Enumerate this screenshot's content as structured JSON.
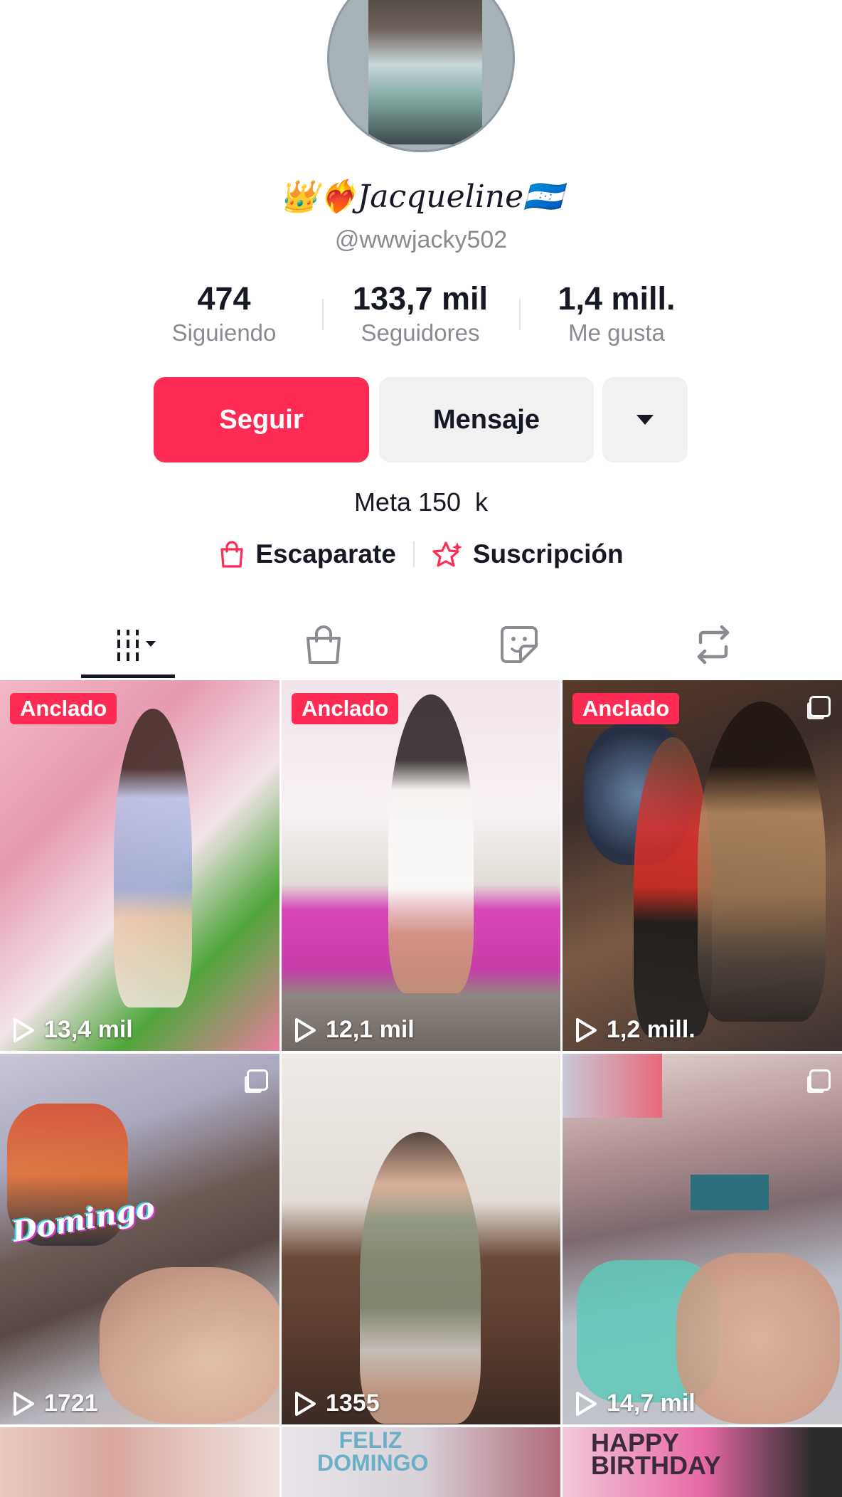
{
  "profile": {
    "display_name": "👑❤️‍🔥Jacqueline🇭🇳",
    "handle": "@wwwjacky502",
    "bio": "Meta 150  k"
  },
  "stats": [
    {
      "value": "474",
      "label": "Siguiendo"
    },
    {
      "value": "133,7 mil",
      "label": "Seguidores"
    },
    {
      "value": "1,4 mill.",
      "label": "Me gusta"
    }
  ],
  "actions": {
    "follow": "Seguir",
    "message": "Mensaje"
  },
  "links": {
    "shop": "Escaparate",
    "subscription": "Suscripción"
  },
  "tabs": [
    "videos-grid-icon",
    "shop-bag-icon",
    "private-sticker-icon",
    "repost-icon"
  ],
  "colors": {
    "accent": "#fe2c55",
    "text": "#161823",
    "secondary": "#8a8b91",
    "button_bg": "#f1f1f2"
  },
  "videos": [
    {
      "pinned_label": "Anclado",
      "views": "13,4 mil"
    },
    {
      "pinned_label": "Anclado",
      "views": "12,1 mil"
    },
    {
      "pinned_label": "Anclado",
      "views": "1,2 mill."
    },
    {
      "views": "1721"
    },
    {
      "views": "1355"
    },
    {
      "views": "14,7 mil"
    }
  ],
  "thumbnail_text": {
    "tile4_sticker": "Domingo",
    "tile8_caption": "FELIZ DOMINGO",
    "tile9_caption": "HAPPY BIRTHDAY"
  }
}
